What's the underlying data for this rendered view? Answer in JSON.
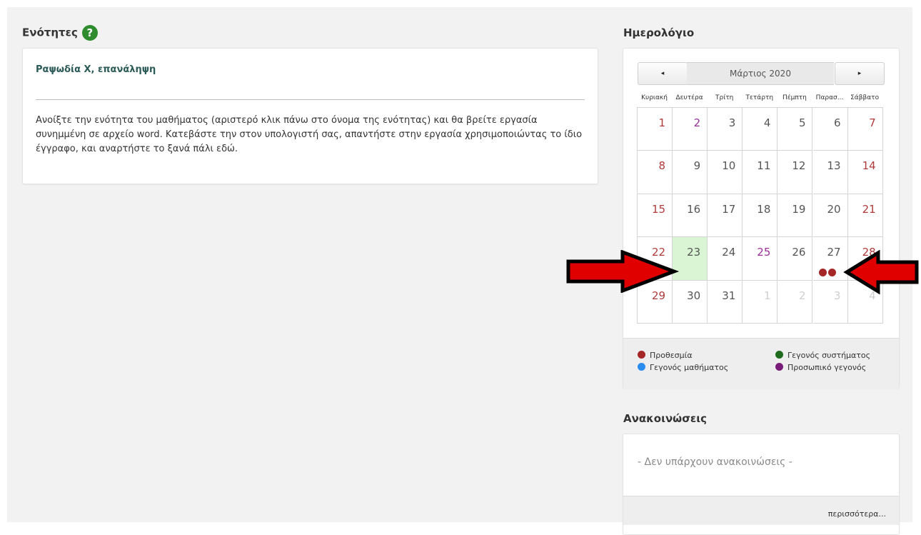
{
  "units": {
    "title": "Ενότητες",
    "help_icon": "?",
    "item": {
      "title": "Ραψωδία Χ, επανάληψη",
      "description": "Ανοίξτε την ενότητα του μαθήματος (αριστερό κλικ πάνω στο όνομα της ενότητας) και θα βρείτε εργασία συνημμένη σε αρχείο word. Κατεβάστε την στον υπολογιστή σας, απαντήστε στην εργασία χρησιμοποιώντας το ίδιο έγγραφο, και αναρτήστε το ξανά πάλι εδώ."
    }
  },
  "calendar": {
    "title": "Ημερολόγιο",
    "month_label": "Μάρτιος 2020",
    "prev_label": "◂",
    "next_label": "▸",
    "weekdays": [
      "Κυριακή",
      "Δευτέρα",
      "Τρίτη",
      "Τετάρτη",
      "Πέμπτη",
      "Παρασ...",
      "Σάββατο"
    ],
    "weeks": [
      [
        "1",
        "2",
        "3",
        "4",
        "5",
        "6",
        "7"
      ],
      [
        "8",
        "9",
        "10",
        "11",
        "12",
        "13",
        "14"
      ],
      [
        "15",
        "16",
        "17",
        "18",
        "19",
        "20",
        "21"
      ],
      [
        "22",
        "23",
        "24",
        "25",
        "26",
        "27",
        "28"
      ],
      [
        "29",
        "30",
        "31",
        "1",
        "2",
        "3",
        "4"
      ]
    ],
    "today": "23",
    "event_days": {
      "course": [
        "2",
        "25"
      ],
      "deadline_dots_on": "27",
      "deadline_dot_count": 2
    },
    "legend": {
      "deadline": {
        "label": "Προθεσμία",
        "color": "#a52626"
      },
      "system_event": {
        "label": "Γεγονός συστήματος",
        "color": "#1e6b1e"
      },
      "course_event": {
        "label": "Γεγονός μαθήματος",
        "color": "#2b8cf0"
      },
      "personal_event": {
        "label": "Προσωπικό γεγονός",
        "color": "#7a1c7a"
      }
    },
    "annotation_color": "#e00000"
  },
  "announcements": {
    "title": "Ανακοινώσεις",
    "empty_text": "- Δεν υπάρχουν ανακοινώσεις -",
    "more_link": "περισσότερα..."
  }
}
